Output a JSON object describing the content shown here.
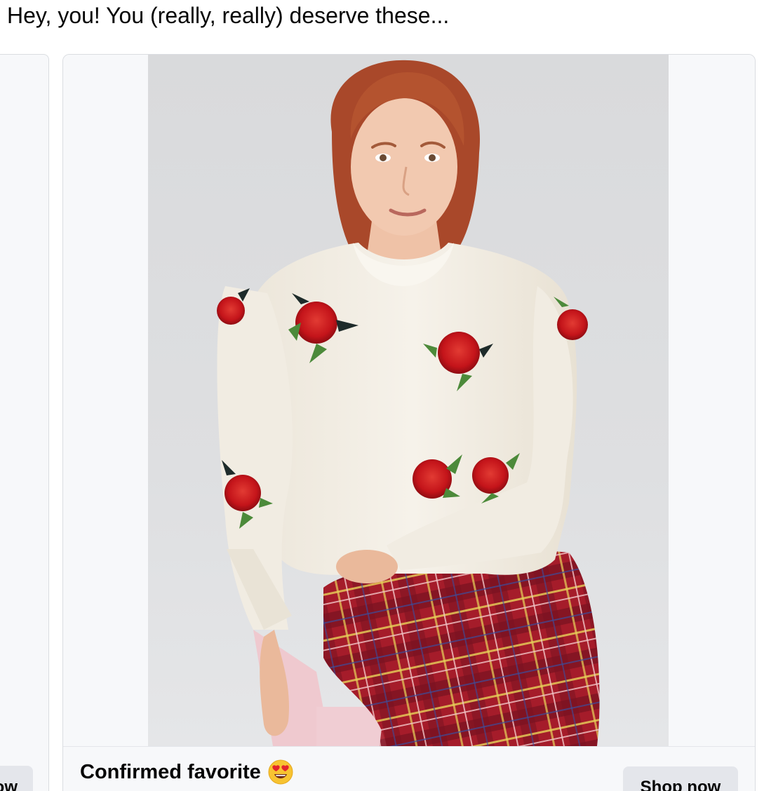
{
  "post": {
    "headline": "Hey, you! You (really, really) deserve these..."
  },
  "carousel": {
    "previous_card": {
      "button_label_visible": "ow"
    },
    "current_card": {
      "image_alt": "",
      "title": "Confirmed favorite",
      "title_emoji": "heart-eyes-emoji-icon",
      "button_label": "Shop now"
    }
  },
  "colors": {
    "card_background": "#f7f8fa",
    "card_border": "#dadde1",
    "button_background": "#e4e6eb",
    "text": "#050505",
    "sweater": "#f3efe6",
    "rose_red": "#c4141a",
    "leaf_green": "#4c8a3a",
    "plaid_red": "#b21f2c"
  }
}
